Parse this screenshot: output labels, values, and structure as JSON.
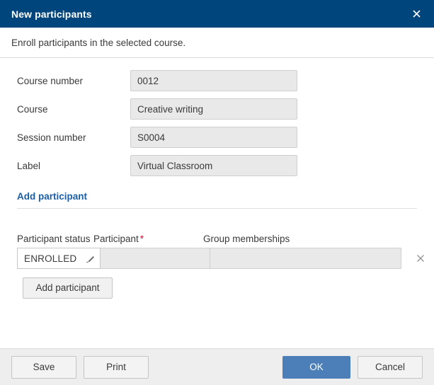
{
  "dialog": {
    "title": "New participants",
    "close_icon": "close-icon",
    "description": "Enroll participants in the selected course."
  },
  "form": {
    "fields": [
      {
        "label": "Course number",
        "value": "0012"
      },
      {
        "label": "Course",
        "value": "Creative writing"
      },
      {
        "label": "Session number",
        "value": "S0004"
      },
      {
        "label": "Label",
        "value": "Virtual Classroom"
      }
    ]
  },
  "add_participant_section": {
    "title": "Add participant",
    "columns": {
      "status": "Participant status",
      "participant": "Participant",
      "participant_required_marker": "*",
      "groups": "Group memberships"
    },
    "rows": [
      {
        "status": "ENROLLED",
        "status_edit_icon": "pencil-icon",
        "participant": "",
        "groups": "",
        "delete_icon": "close-icon"
      }
    ],
    "add_button_label": "Add participant"
  },
  "footer": {
    "save_label": "Save",
    "print_label": "Print",
    "ok_label": "OK",
    "cancel_label": "Cancel"
  },
  "colors": {
    "titlebar": "#00457c",
    "section_heading": "#1a5ea8",
    "primary_button": "#4c7fb8",
    "required_marker": "#c8102e",
    "field_background": "#e9e9e9",
    "footer_background": "#eeeeee"
  }
}
